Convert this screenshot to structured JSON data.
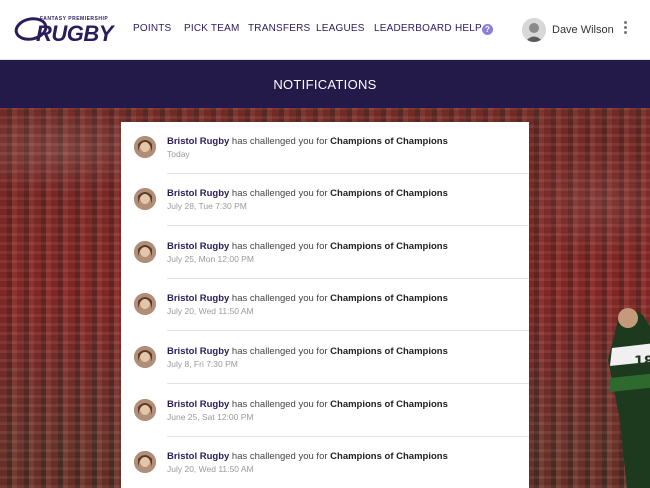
{
  "nav": {
    "logo_small": "FANTASY PREMIERSHIP",
    "logo_big": "RUGBY",
    "items": [
      "POINTS",
      "PICK TEAM",
      "TRANSFERS",
      "LEAGUES",
      "LEADERBOARD",
      "HELP"
    ],
    "help_badge": "?",
    "user_name": "Dave Wilson"
  },
  "page": {
    "title": "NOTIFICATIONS"
  },
  "notification_text": {
    "connector": " has challenged you for "
  },
  "notifications": [
    {
      "club": "Bristol Rugby",
      "league": "Champions of Champions",
      "time": "Today"
    },
    {
      "club": "Bristol Rugby",
      "league": "Champions of Champions",
      "time": "July 28, Tue 7:30 PM"
    },
    {
      "club": "Bristol Rugby",
      "league": "Champions of Champions",
      "time": "July 25, Mon 12:00 PM"
    },
    {
      "club": "Bristol Rugby",
      "league": "Champions of Champions",
      "time": "July 20, Wed 11:50 AM"
    },
    {
      "club": "Bristol Rugby",
      "league": "Champions of Champions",
      "time": "July 8, Fri 7:30 PM"
    },
    {
      "club": "Bristol Rugby",
      "league": "Champions of Champions",
      "time": "June 25, Sat 12:00 PM"
    },
    {
      "club": "Bristol Rugby",
      "league": "Champions of Champions",
      "time": "July 20, Wed 11:50 AM"
    }
  ],
  "colors": {
    "brand": "#2b1d5c",
    "header_bar": "#231a4a",
    "help_badge": "#8d7fd6",
    "timestamp": "#9a9a9a"
  }
}
